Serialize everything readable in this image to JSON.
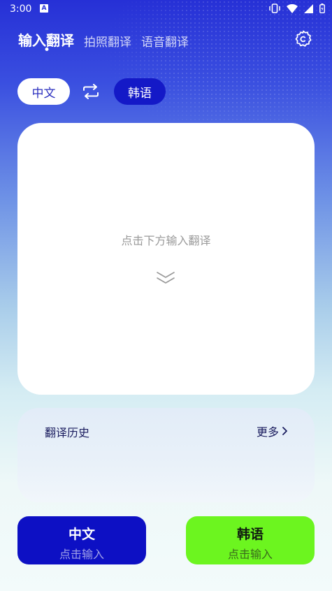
{
  "status_bar": {
    "time": "3:00",
    "notification_letter": "A"
  },
  "tabs": [
    {
      "label": "输入翻译",
      "active": true
    },
    {
      "label": "拍照翻译",
      "active": false
    },
    {
      "label": "语音翻译",
      "active": false
    }
  ],
  "language": {
    "source": "中文",
    "target": "韩语"
  },
  "input_card": {
    "hint": "点击下方输入翻译"
  },
  "history": {
    "title": "翻译历史",
    "more": "更多"
  },
  "buttons": {
    "chinese": {
      "title": "中文",
      "subtitle": "点击输入"
    },
    "korean": {
      "title": "韩语",
      "subtitle": "点击输入"
    }
  },
  "colors": {
    "accent_blue": "#0d10c4",
    "accent_green": "#6cf51f",
    "header_gradient_top": "#2630d6"
  },
  "icons": [
    "settings-icon",
    "swap-icon",
    "chevron-double-down-icon",
    "chevron-right-icon",
    "vibrate-icon",
    "wifi-icon",
    "signal-icon",
    "battery-icon"
  ]
}
